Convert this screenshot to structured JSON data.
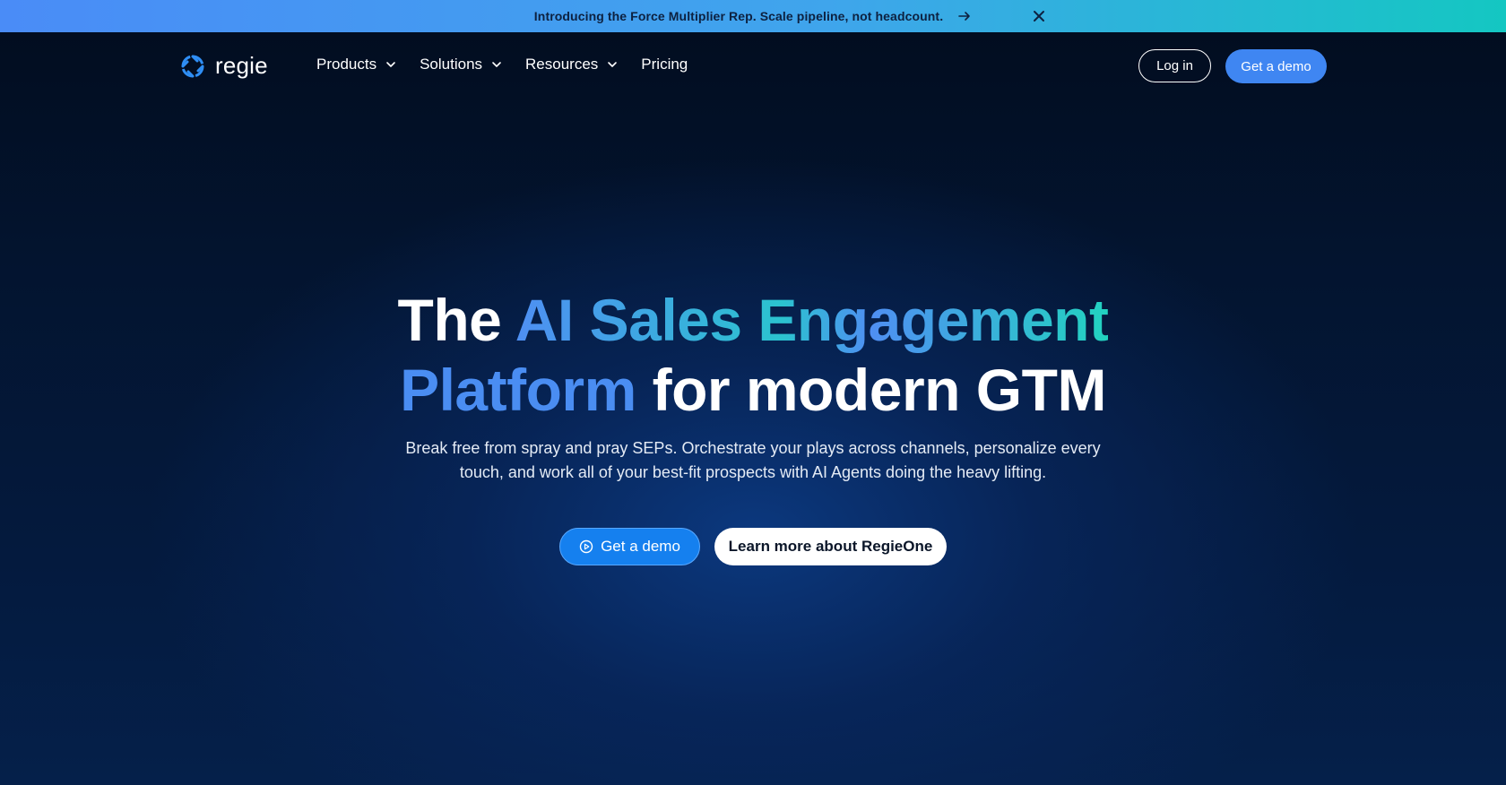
{
  "banner": {
    "text": "Introducing the Force Multiplier Rep. Scale pipeline, not headcount.",
    "arrow_icon": "arrow-right-icon",
    "close_icon": "close-icon"
  },
  "nav": {
    "logo_text": "regie",
    "items": [
      {
        "label": "Products",
        "has_dropdown": true
      },
      {
        "label": "Solutions",
        "has_dropdown": true
      },
      {
        "label": "Resources",
        "has_dropdown": true
      },
      {
        "label": "Pricing",
        "has_dropdown": false
      }
    ],
    "login_label": "Log in",
    "demo_label": "Get a demo"
  },
  "hero": {
    "title_part1": "The ",
    "title_highlight1": "AI Sales Engagement",
    "title_highlight2": "Platform",
    "title_part2": " for modern GTM",
    "subtitle": "Break free from spray and pray SEPs. Orchestrate your plays across channels, personalize every touch, and work all of your best-fit prospects with AI Agents doing the heavy lifting.",
    "cta_primary": "Get a demo",
    "cta_secondary": "Learn more about RegieOne"
  },
  "colors": {
    "accent_blue": "#3f86f2",
    "accent_teal": "#22d3c0",
    "background": "#03122a"
  }
}
